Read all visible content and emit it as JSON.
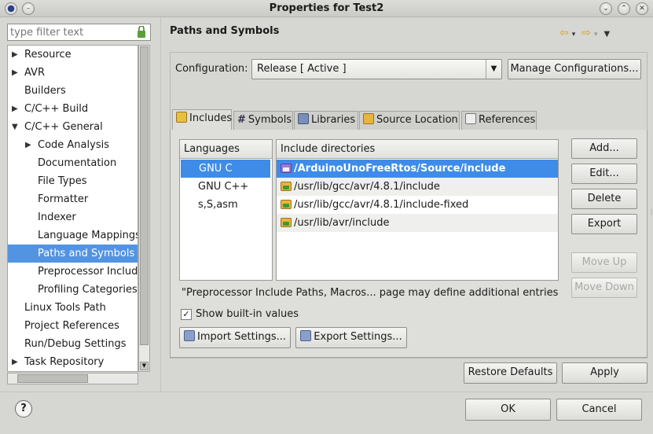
{
  "window": {
    "title": "Properties for Test2"
  },
  "filter": {
    "placeholder": "type filter text"
  },
  "tree": [
    {
      "label": "Resource",
      "indent": 0,
      "expander": "▶"
    },
    {
      "label": "AVR",
      "indent": 0,
      "expander": "▶"
    },
    {
      "label": "Builders",
      "indent": 0,
      "expander": ""
    },
    {
      "label": "C/C++ Build",
      "indent": 0,
      "expander": "▶"
    },
    {
      "label": "C/C++ General",
      "indent": 0,
      "expander": "▼"
    },
    {
      "label": "Code Analysis",
      "indent": 1,
      "expander": "▶"
    },
    {
      "label": "Documentation",
      "indent": 1,
      "expander": ""
    },
    {
      "label": "File Types",
      "indent": 1,
      "expander": ""
    },
    {
      "label": "Formatter",
      "indent": 1,
      "expander": ""
    },
    {
      "label": "Indexer",
      "indent": 1,
      "expander": ""
    },
    {
      "label": "Language Mappings",
      "indent": 1,
      "expander": ""
    },
    {
      "label": "Paths and Symbols",
      "indent": 1,
      "expander": "",
      "selected": true
    },
    {
      "label": "Preprocessor Includ",
      "indent": 1,
      "expander": ""
    },
    {
      "label": "Profiling Categories",
      "indent": 1,
      "expander": ""
    },
    {
      "label": "Linux Tools Path",
      "indent": 0,
      "expander": ""
    },
    {
      "label": "Project References",
      "indent": 0,
      "expander": ""
    },
    {
      "label": "Run/Debug Settings",
      "indent": 0,
      "expander": ""
    },
    {
      "label": "Task Repository",
      "indent": 0,
      "expander": "▶"
    }
  ],
  "page": {
    "title": "Paths and Symbols",
    "config_label": "Configuration:",
    "config_value": "Release  [ Active ]",
    "manage_btn": "Manage Configurations...",
    "tabs": [
      {
        "label": "Includes",
        "icon": "includes-icon",
        "active": true
      },
      {
        "label": "Symbols",
        "icon": "hash-icon"
      },
      {
        "label": "Libraries",
        "icon": "library-icon"
      },
      {
        "label": "Source Location",
        "icon": "folder-icon"
      },
      {
        "label": "References",
        "icon": "references-icon"
      }
    ],
    "languages_header": "Languages",
    "languages": [
      "GNU C",
      "GNU C++",
      "s,S,asm"
    ],
    "includes_header": "Include directories",
    "includes": [
      {
        "path": "/ArduinoUnoFreeRtos/Source/include",
        "workspace": true
      },
      {
        "path": "/usr/lib/gcc/avr/4.8.1/include"
      },
      {
        "path": "/usr/lib/gcc/avr/4.8.1/include-fixed"
      },
      {
        "path": "/usr/lib/avr/include"
      }
    ],
    "side_buttons": [
      "Add...",
      "Edit...",
      "Delete",
      "Export"
    ],
    "move_up": "Move Up",
    "move_down": "Move Down",
    "note": "\"Preprocessor Include Paths, Macros... page may define additional entries",
    "show_builtin": "Show built-in values",
    "import_btn": "Import Settings...",
    "export_btn": "Export Settings..."
  },
  "footer": {
    "restore": "Restore Defaults",
    "apply": "Apply",
    "ok": "OK",
    "cancel": "Cancel",
    "help": "?"
  },
  "colors": {
    "selection": "#5294e2",
    "row_selection": "#3f8ce8"
  }
}
